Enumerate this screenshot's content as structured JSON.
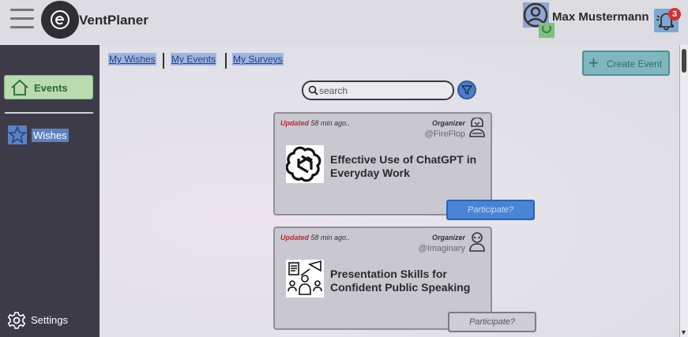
{
  "app": {
    "title": "VentPlaner"
  },
  "user": {
    "name": "Max Mustermann",
    "notification_count": "3"
  },
  "sidebar": {
    "items": [
      {
        "label": "Events",
        "icon": "home-icon"
      },
      {
        "label": "Wishes",
        "icon": "star-icon"
      }
    ],
    "settings_label": "Settings"
  },
  "tabs": [
    "My Wishes",
    "My Events",
    "My Surveys"
  ],
  "create_button": "Create Event",
  "search": {
    "placeholder": "search"
  },
  "events": [
    {
      "updated_label": "Updated",
      "updated_time": "58 min ago..",
      "organizer_label": "Organizer",
      "organizer_handle": "@FireFlop",
      "title": "Effective Use of ChatGPT in Everyday Work",
      "thumbnail_icon": "openai-logo",
      "participate_label": "Participate?",
      "participate_state": "active"
    },
    {
      "updated_label": "Updated",
      "updated_time": "58 min ago..",
      "organizer_label": "Organizer",
      "organizer_handle": "@Imaginary",
      "title": "Presentation Skills for Confident Public Speaking",
      "thumbnail_icon": "presentation-icon",
      "participate_label": "Participate?",
      "participate_state": "inactive"
    }
  ],
  "colors": {
    "sidebar_bg": "#3d3b48",
    "events_active": "#b9dbb0",
    "participate_active": "#4a84d6",
    "badge": "#d72f2f",
    "create_button": "#7fb7bf"
  }
}
